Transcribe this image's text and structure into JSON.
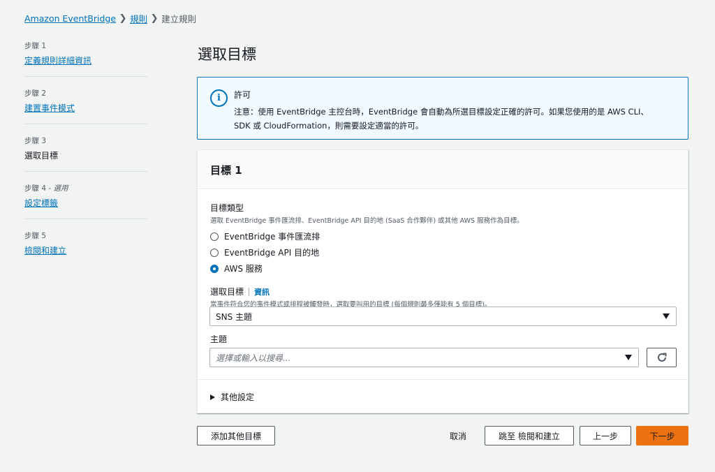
{
  "breadcrumb": {
    "items": [
      "Amazon EventBridge",
      "規則"
    ],
    "current": "建立規則"
  },
  "steps": [
    {
      "num": "步驟 1",
      "label": "定義規則詳細資訊"
    },
    {
      "num": "步驟 2",
      "label": "建置事件模式"
    },
    {
      "num": "步驟 3",
      "label": "選取目標"
    },
    {
      "num": "步驟 4 -",
      "optional": "選用",
      "label": "設定標籤"
    },
    {
      "num": "步驟 5",
      "label": "檢閱和建立"
    }
  ],
  "page_title": "選取目標",
  "alert": {
    "title": "許可",
    "line1": "注意：使用 EventBridge 主控台時，EventBridge 會自動為所選目標設定正確的許可。如果您使用的是 AWS CLI、",
    "line2": "SDK 或 CloudFormation，則需要設定適當的許可。",
    "icon": "info-circle-icon",
    "accent": "#0073bb"
  },
  "target": {
    "header": "目標 1",
    "type_label": "目標類型",
    "type_desc": "選取 EventBridge 事件匯流排、EventBridge API 目的地 (SaaS 合作夥伴) 或其他 AWS 服務作為目標。",
    "options": [
      "EventBridge 事件匯流排",
      "EventBridge API 目的地",
      "AWS 服務"
    ],
    "selected_option": "AWS 服務",
    "select_label": "選取目標",
    "info_link": "資訊",
    "select_desc": "當事件符合您的事件模式或排程被觸發時，選取要叫用的目標 (每個規則最多僅能有 5 個目標)。",
    "select_value": "SNS 主題",
    "topic_label": "主題",
    "topic_placeholder": "選擇或輸入以搜尋...",
    "additional_settings": "其他設定"
  },
  "actions": {
    "add_target": "添加其他目標",
    "cancel": "取消",
    "skip": "跳至 檢閱和建立",
    "previous": "上一步",
    "next": "下一步",
    "primary_color": "#ec7211"
  }
}
